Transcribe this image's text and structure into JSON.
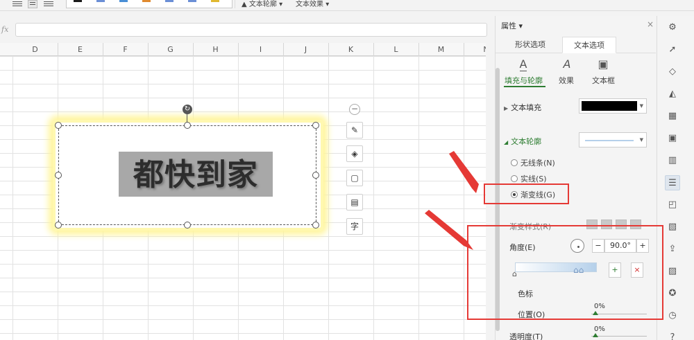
{
  "ribbon": {
    "text_outline_label": "文本轮廓",
    "text_effect_label": "文本效果",
    "swatch_colors": [
      "#1a1a1a",
      "#6b8fd6",
      "#4a8fd6",
      "#e08a2f",
      "#6b8fd6",
      "#6b8fd6",
      "#e0b82f"
    ]
  },
  "formula": {
    "fx_label": "fx",
    "value": ""
  },
  "sheet": {
    "columns": [
      "D",
      "E",
      "F",
      "G",
      "H",
      "I",
      "J",
      "K",
      "L",
      "M",
      "N"
    ],
    "shape_text": "都快到家",
    "glow_color": "#fff59a",
    "text_highlight_color": "#a8a8a8"
  },
  "quick_toolbar": {
    "collapse_icon": "minus-circle-icon",
    "items": [
      {
        "name": "pen-style-icon",
        "glyph": "✎"
      },
      {
        "name": "fill-bucket-icon",
        "glyph": "◈"
      },
      {
        "name": "shape-outline-icon",
        "glyph": "▢"
      },
      {
        "name": "text-box-icon",
        "glyph": "▤"
      },
      {
        "name": "text-style-icon",
        "glyph": "字"
      }
    ]
  },
  "panel": {
    "header": "属性",
    "header_caret": "▾",
    "close": "×",
    "tabs": [
      {
        "label": "形状选项",
        "active": false
      },
      {
        "label": "文本选项",
        "active": true
      }
    ],
    "subtabs": [
      {
        "label": "填充与轮廓",
        "glyph": "A",
        "active": true
      },
      {
        "label": "效果",
        "glyph": "A",
        "active": false
      },
      {
        "label": "文本框",
        "glyph": "▣",
        "active": false
      }
    ],
    "text_fill_label": "文本填充",
    "text_fill_color": "#000000",
    "text_outline_label": "文本轮廓",
    "text_outline_line_color": "#b5d0ea",
    "radios": [
      {
        "label": "无线条(N)",
        "checked": false
      },
      {
        "label": "实线(S)",
        "checked": false
      },
      {
        "label": "渐变线(G)",
        "checked": true
      }
    ],
    "gradient_style_label": "渐变样式(R)",
    "angle_label": "角度(E)",
    "angle_value": "90.0°",
    "angle_minus": "−",
    "angle_plus": "+",
    "color_stop_label": "色标",
    "position_label": "位置(O)",
    "position_value": "0%",
    "transparency_label": "透明度(T)",
    "transparency_value": "0%",
    "add_stop_label": "+",
    "remove_stop_label": "×"
  },
  "right_toolbar": {
    "items": [
      {
        "name": "settings-icon",
        "glyph": "⚙",
        "active": false
      },
      {
        "name": "cursor-icon",
        "glyph": "➚",
        "active": false
      },
      {
        "name": "shapes-icon",
        "glyph": "◇",
        "active": false
      },
      {
        "name": "fill-icon",
        "glyph": "◭",
        "active": false
      },
      {
        "name": "table-icon",
        "glyph": "▦",
        "active": false
      },
      {
        "name": "grid-icon",
        "glyph": "▣",
        "active": false
      },
      {
        "name": "chart-icon",
        "glyph": "▥",
        "active": false
      },
      {
        "name": "properties-icon",
        "glyph": "☰",
        "active": true
      },
      {
        "name": "disabled-icon",
        "glyph": "◰",
        "active": false
      },
      {
        "name": "image-edit-icon",
        "glyph": "▧",
        "active": false
      },
      {
        "name": "share-icon",
        "glyph": "⇪",
        "active": false
      },
      {
        "name": "picture-icon",
        "glyph": "▨",
        "active": false
      },
      {
        "name": "star-icon",
        "glyph": "✪",
        "active": false
      },
      {
        "name": "history-icon",
        "glyph": "◷",
        "active": false
      },
      {
        "name": "help-icon",
        "glyph": "?",
        "active": false
      }
    ]
  },
  "annotation": {
    "highlight_color": "#e53935"
  }
}
